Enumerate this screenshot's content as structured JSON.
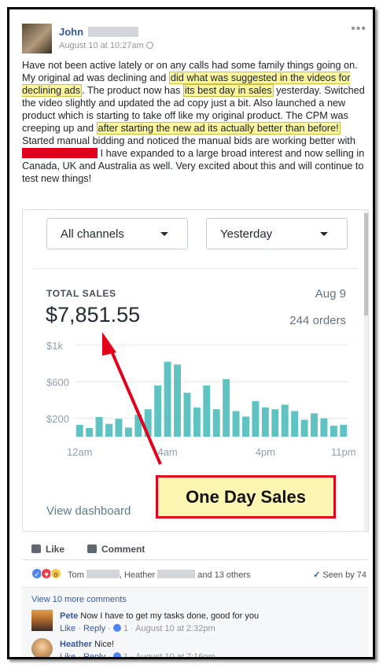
{
  "post": {
    "author_name": "John",
    "timestamp": "August 10 at 10:27am",
    "body": {
      "p1": "Have not been active lately or on any calls had some family things going on. My original ad was declining and ",
      "h1": "did what was suggested in the videos for declining ads",
      "p2": ". The product now has ",
      "h2": "its best day in sales",
      "p3": " yesterday. Switched the video slightly and updated the ad copy just a bit. Also launched a new product which is starting to take off like my original product. The CPM was creeping up and ",
      "h3": "after starting the new ad its actually better than before!",
      "p4": " Started manual bidding and noticed the manual bids are working better with ",
      "p5": " I have expanded to a large broad interest and now selling in Canada, UK and Australia as well. Very excited about this and will continue to test new things!"
    }
  },
  "embed": {
    "channel_dropdown": "All channels",
    "date_dropdown": "Yesterday",
    "sales_label": "TOTAL SALES",
    "sales_date": "Aug 9",
    "sales_value": "$7,851.55",
    "orders": "244 orders",
    "view_dashboard": "View dashboard"
  },
  "chart_data": {
    "type": "bar",
    "ytick_labels": [
      "$1k",
      "$600",
      "$200"
    ],
    "yticks": [
      1000,
      600,
      200
    ],
    "xtick_labels": [
      "12am",
      "4am",
      "4pm",
      "11pm"
    ],
    "xtick_index": [
      0,
      9,
      19,
      27
    ],
    "ylim": [
      0,
      1050
    ],
    "categories": [
      "12am",
      "1",
      "2",
      "3",
      "4",
      "5",
      "6",
      "7",
      "8",
      "9",
      "10",
      "11",
      "12pm",
      "13",
      "14",
      "15",
      "16",
      "17",
      "18",
      "19",
      "20",
      "21",
      "22",
      "23",
      "24",
      "25",
      "26",
      "27"
    ],
    "values": [
      130,
      95,
      215,
      140,
      195,
      100,
      240,
      300,
      560,
      820,
      790,
      480,
      320,
      560,
      300,
      630,
      280,
      220,
      390,
      320,
      300,
      350,
      280,
      185,
      255,
      200,
      120,
      130
    ],
    "color": "#5fc3c3"
  },
  "annotation": {
    "callout_text": "One Day Sales",
    "arrow_color": "#e2001a"
  },
  "actions": {
    "like_label": "Like",
    "comment_label": "Comment"
  },
  "reactions": {
    "name1": "Tom",
    "name2": "Heather",
    "others": "and 13 others",
    "seen_by": "Seen by 74"
  },
  "comments": {
    "view_more": "View 10 more comments",
    "items": [
      {
        "author": "Pete",
        "text": "Now I have to get my tasks done, good for you",
        "like": "Like",
        "reply": "Reply",
        "likes": "1",
        "time": "August 10 at 2:32pm"
      },
      {
        "author": "Heather",
        "text": "Nice!",
        "like": "Like",
        "reply": "Reply",
        "likes": "1",
        "time": "August 10 at 7:16pm"
      }
    ]
  },
  "icons": {
    "like": "thumbs-up-icon",
    "comment": "speech-bubble-icon",
    "seen": "checkmark-icon",
    "more": "more-options-icon",
    "privacy": "globe-icon"
  }
}
